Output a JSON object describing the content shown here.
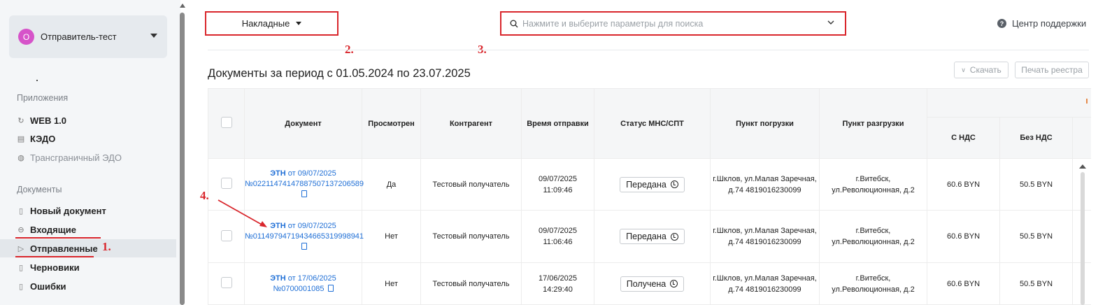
{
  "sidebar": {
    "account": {
      "initial": "О",
      "name": "Отправитель-тест"
    },
    "apps_title": "Приложения",
    "apps": [
      {
        "label": "WEB 1.0"
      },
      {
        "label": "КЭДО"
      },
      {
        "label": "Трансграничный ЭДО"
      }
    ],
    "docs_title": "Документы",
    "docs": [
      {
        "label": "Новый документ"
      },
      {
        "label": "Входящие"
      },
      {
        "label": "Отправленные"
      },
      {
        "label": "Черновики"
      },
      {
        "label": "Ошибки"
      }
    ]
  },
  "header": {
    "doc_type": "Накладные",
    "search_placeholder": "Нажмите и выберите параметры для поиска",
    "help": "Центр поддержки"
  },
  "main": {
    "period_title": "Документы за период с 01.05.2024 по 23.07.2025",
    "download": "Скачать",
    "print_registry": "Печать реестра"
  },
  "table": {
    "headers": {
      "document": "Документ",
      "viewed": "Просмотрен",
      "counterparty": "Контрагент",
      "sent_time": "Время отправки",
      "status": "Статус МНС/СПТ",
      "load_point": "Пункт погрузки",
      "unload_point": "Пункт разгрузки",
      "with_vat": "С НДС",
      "without_vat": "Без НДС"
    },
    "rows": [
      {
        "doc_type": "ЭТН",
        "doc_date": "от 09/07/2025",
        "doc_number": "№02211474147887507137206589",
        "viewed": "Да",
        "counterparty": "Тестовый получатель",
        "sent_date": "09/07/2025",
        "sent_time": "11:09:46",
        "status": "Передана",
        "load_line1": "г.Шклов, ул.Малая Заречная,",
        "load_line2": "д.74 4819016230099",
        "unload_line1": "г.Витебск,",
        "unload_line2": "ул.Революционная, д.2",
        "with_vat": "60.6 BYN",
        "without_vat": "50.5 BYN"
      },
      {
        "doc_type": "ЭТН",
        "doc_date": "от 09/07/2025",
        "doc_number": "№01149794719434665319998941",
        "viewed": "Нет",
        "counterparty": "Тестовый получатель",
        "sent_date": "09/07/2025",
        "sent_time": "11:06:46",
        "status": "Передана",
        "load_line1": "г.Шклов, ул.Малая Заречная,",
        "load_line2": "д.74 4819016230099",
        "unload_line1": "г.Витебск,",
        "unload_line2": "ул.Революционная, д.2",
        "with_vat": "60.6 BYN",
        "without_vat": "50.5 BYN"
      },
      {
        "doc_type": "ЭТН",
        "doc_date": "от 17/06/2025",
        "doc_number": "№0700001085",
        "viewed": "Нет",
        "counterparty": "Тестовый получатель",
        "sent_date": "17/06/2025",
        "sent_time": "14:29:40",
        "status": "Получена",
        "load_line1": "г.Шклов, ул.Малая Заречная,",
        "load_line2": "д.74 4819016230099",
        "unload_line1": "г.Витебск,",
        "unload_line2": "ул.Революционная, д.2",
        "with_vat": "60.6 BYN",
        "without_vat": "50.5 BYN"
      }
    ]
  },
  "annotations": {
    "n1": "1.",
    "n2": "2.",
    "n3": "3.",
    "n4": "4."
  },
  "colors": {
    "annotation_red": "#d9262c",
    "link_blue": "#1f6fd6",
    "avatar_pink": "#d653c9"
  }
}
